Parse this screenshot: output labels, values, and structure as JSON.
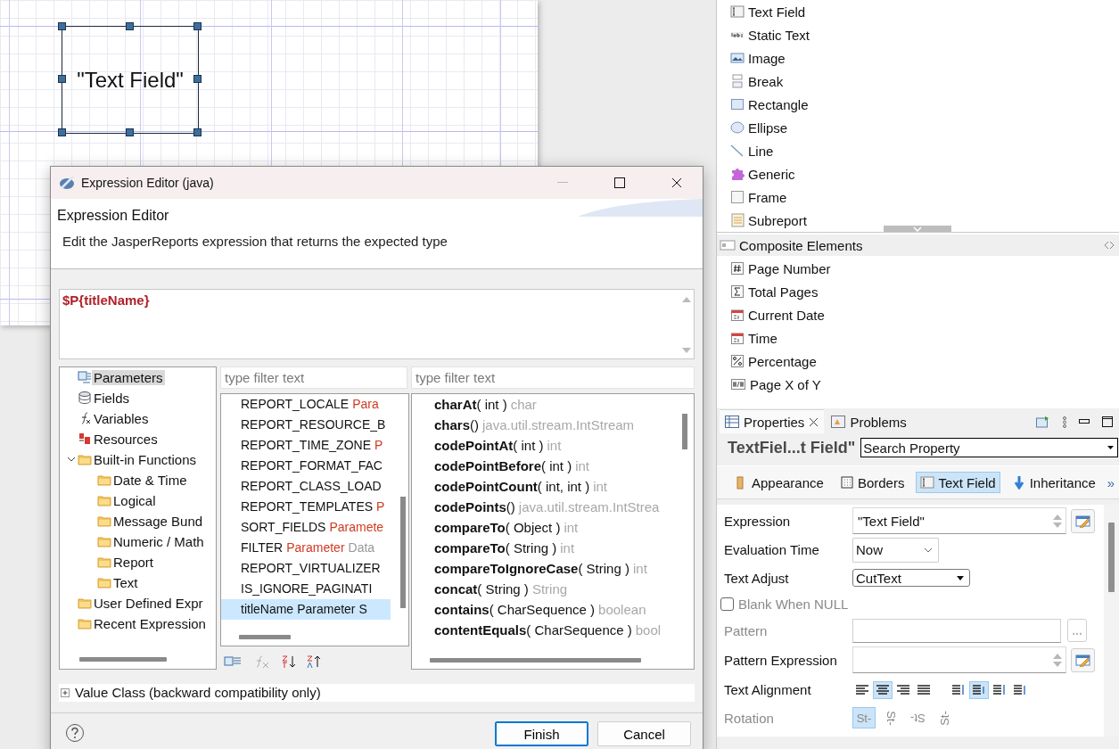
{
  "canvas": {
    "element_text": "\"Text Field\""
  },
  "palette": {
    "items": [
      {
        "label": "Text Field",
        "kind": "textfield"
      },
      {
        "label": "Static Text",
        "kind": "statictext"
      },
      {
        "label": "Image",
        "kind": "image"
      },
      {
        "label": "Break",
        "kind": "break"
      },
      {
        "label": "Rectangle",
        "kind": "rectangle"
      },
      {
        "label": "Ellipse",
        "kind": "ellipse"
      },
      {
        "label": "Line",
        "kind": "line"
      },
      {
        "label": "Generic",
        "kind": "generic"
      },
      {
        "label": "Frame",
        "kind": "frame"
      },
      {
        "label": "Subreport",
        "kind": "subreport"
      }
    ],
    "composite": {
      "title": "Composite Elements",
      "items": [
        {
          "label": "Page Number",
          "kind": "hash"
        },
        {
          "label": "Total Pages",
          "kind": "sigma"
        },
        {
          "label": "Current Date",
          "kind": "calendar"
        },
        {
          "label": "Time",
          "kind": "calendar"
        },
        {
          "label": "Percentage",
          "kind": "percent"
        },
        {
          "label": "Page X of Y",
          "kind": "pagexy"
        }
      ]
    }
  },
  "properties": {
    "tabs": [
      {
        "label": "Properties",
        "selected": true,
        "closable": true
      },
      {
        "label": "Problems",
        "selected": false,
        "closable": false
      }
    ],
    "element_title": "TextFiel...t Field\"",
    "search": {
      "value": "Search Property"
    },
    "sections": [
      {
        "label": "Appearance",
        "selected": false,
        "kind": "appearance"
      },
      {
        "label": "Borders",
        "selected": false,
        "kind": "borders"
      },
      {
        "label": "Text Field",
        "selected": true,
        "kind": "textfield"
      },
      {
        "label": "Inheritance",
        "selected": false,
        "kind": "inheritance"
      }
    ],
    "more": "»",
    "rows": [
      {
        "kind": "expression",
        "label": "Expression",
        "value": "\"Text Field\"",
        "disabled": false
      },
      {
        "kind": "select",
        "label": "Evaluation Time",
        "value": "Now",
        "disabled": false
      },
      {
        "kind": "combo",
        "label": "Text Adjust",
        "value": "CutText",
        "disabled": false
      },
      {
        "kind": "checkbox",
        "label": "Blank When NULL",
        "checked": false,
        "disabled": true
      },
      {
        "kind": "pattern",
        "label": "Pattern",
        "button": "...",
        "disabled": true
      },
      {
        "kind": "expression",
        "label": "Pattern Expression",
        "disabled": false
      },
      {
        "kind": "alignment",
        "label": "Text Alignment",
        "disabled": false,
        "horizontal": [
          {
            "selected": false
          },
          {
            "selected": true
          },
          {
            "selected": false
          },
          {
            "selected": false
          }
        ],
        "vertical": [
          {
            "selected": false
          },
          {
            "selected": true
          },
          {
            "selected": false
          },
          {
            "selected": false
          }
        ]
      },
      {
        "kind": "rotation",
        "label": "Rotation",
        "disabled": true,
        "options": [
          {
            "label": "St-",
            "selected": true
          },
          {
            "label": "St-",
            "selected": false
          },
          {
            "label": "St-",
            "selected": false
          },
          {
            "label": "St-",
            "selected": false
          }
        ]
      }
    ]
  },
  "dialog": {
    "title": "Expression Editor (java)",
    "heading": "Expression Editor",
    "description": "Edit the JasperReports expression that returns the expected type",
    "expression": "$P{titleName}",
    "tree": [
      {
        "label": "Parameters",
        "kind": "parameter",
        "selected": true
      },
      {
        "label": "Fields",
        "kind": "field",
        "selected": false
      },
      {
        "label": "Variables",
        "kind": "variable",
        "selected": false
      },
      {
        "label": "Resources",
        "kind": "resource",
        "selected": false
      },
      {
        "label": "Built-in Functions",
        "kind": "folder",
        "selected": false,
        "expanded": true,
        "children": [
          {
            "label": "Date & Time",
            "kind": "folder",
            "selected": false
          },
          {
            "label": "Logical",
            "kind": "folder",
            "selected": false
          },
          {
            "label": "Message Bund",
            "kind": "folder",
            "selected": false
          },
          {
            "label": "Numeric / Math",
            "kind": "folder",
            "selected": false
          },
          {
            "label": "Report",
            "kind": "folder",
            "selected": false
          },
          {
            "label": "Text",
            "kind": "folder",
            "selected": false
          }
        ]
      },
      {
        "label": "User Defined Expr",
        "kind": "folder",
        "selected": false
      },
      {
        "label": "Recent Expression",
        "kind": "folder",
        "selected": false
      }
    ],
    "items_filter": {
      "placeholder": "type filter text"
    },
    "items": [
      {
        "name": "REPORT_LOCALE",
        "type": "Para",
        "selected": false
      },
      {
        "name": "REPORT_RESOURCE_B",
        "selected": false
      },
      {
        "name": "REPORT_TIME_ZONE",
        "type": "P",
        "selected": false
      },
      {
        "name": "REPORT_FORMAT_FAC",
        "selected": false
      },
      {
        "name": "REPORT_CLASS_LOAD",
        "selected": false
      },
      {
        "name": "REPORT_TEMPLATES",
        "type": "P",
        "selected": false
      },
      {
        "name": "SORT_FIELDS",
        "type": "Paramete",
        "selected": false
      },
      {
        "name": "FILTER",
        "type": "Parameter",
        "extra": "Data",
        "selected": false
      },
      {
        "name": "REPORT_VIRTUALIZER",
        "selected": false
      },
      {
        "name": "IS_IGNORE_PAGINATI",
        "selected": false
      },
      {
        "name": "titleName",
        "type": "Parameter S",
        "selected": true
      }
    ],
    "methods_filter": {
      "placeholder": "type filter text"
    },
    "methods": [
      {
        "name": "charAt",
        "params": "( int )",
        "returns": "char"
      },
      {
        "name": "chars",
        "params": "()",
        "returns": "java.util.stream.IntStream"
      },
      {
        "name": "codePointAt",
        "params": "( int )",
        "returns": "int"
      },
      {
        "name": "codePointBefore",
        "params": "( int )",
        "returns": "int"
      },
      {
        "name": "codePointCount",
        "params": "( int, int )",
        "returns": "int"
      },
      {
        "name": "codePoints",
        "params": "()",
        "returns": "java.util.stream.IntStrea"
      },
      {
        "name": "compareTo",
        "params": "( Object )",
        "returns": "int"
      },
      {
        "name": "compareTo",
        "params": "( String )",
        "returns": "int"
      },
      {
        "name": "compareToIgnoreCase",
        "params": "( String )",
        "returns": "int"
      },
      {
        "name": "concat",
        "params": "( String )",
        "returns": "String"
      },
      {
        "name": "contains",
        "params": "( CharSequence )",
        "returns": "boolean"
      },
      {
        "name": "contentEquals",
        "params": "( CharSequence )",
        "returns": "bool"
      }
    ],
    "value_class": {
      "label": "Value Class (backward compatibility only)",
      "expanded": false
    },
    "buttons": [
      {
        "label": "Finish",
        "default": true
      },
      {
        "label": "Cancel",
        "default": false
      }
    ]
  }
}
